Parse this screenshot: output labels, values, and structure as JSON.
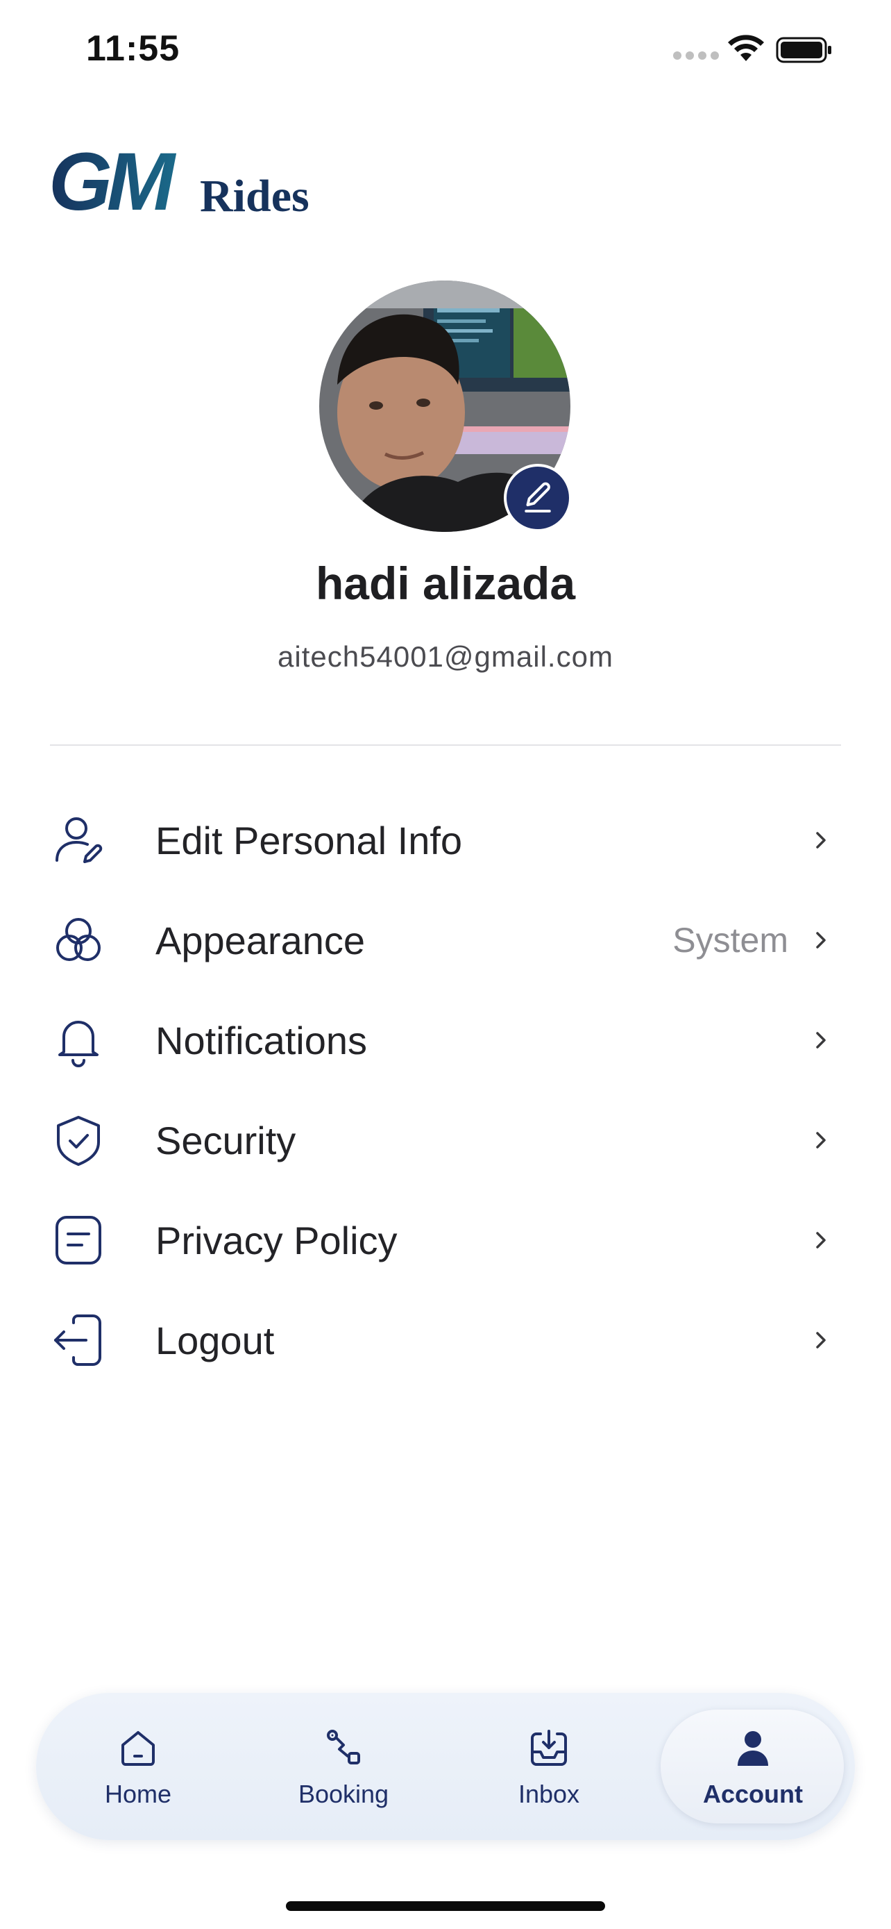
{
  "status_bar": {
    "time": "11:55"
  },
  "brand": {
    "logo_mark": "GM",
    "logo_text": "Rides",
    "color_dark": "#16325c",
    "color_teal": "#1b6a8a"
  },
  "profile": {
    "name": "hadi alizada",
    "email": "aitech54001@gmail.com",
    "avatar_icon": "user-photo",
    "edit_icon": "pencil-icon"
  },
  "menu": {
    "items": [
      {
        "label": "Edit Personal Info",
        "icon": "user-edit-icon",
        "value": ""
      },
      {
        "label": "Appearance",
        "icon": "palette-circles-icon",
        "value": "System"
      },
      {
        "label": "Notifications",
        "icon": "bell-icon",
        "value": ""
      },
      {
        "label": "Security",
        "icon": "shield-check-icon",
        "value": ""
      },
      {
        "label": "Privacy Policy",
        "icon": "document-icon",
        "value": ""
      },
      {
        "label": "Logout",
        "icon": "logout-icon",
        "value": ""
      }
    ]
  },
  "tabbar": {
    "tabs": [
      {
        "label": "Home",
        "icon": "home-icon"
      },
      {
        "label": "Booking",
        "icon": "route-icon"
      },
      {
        "label": "Inbox",
        "icon": "inbox-icon"
      },
      {
        "label": "Account",
        "icon": "account-icon",
        "active": true
      }
    ]
  },
  "colors": {
    "accent": "#1f2f68",
    "muted": "#8e8e93",
    "divider": "#e3e3e6",
    "tabbar_bg": "#e9eff8"
  }
}
